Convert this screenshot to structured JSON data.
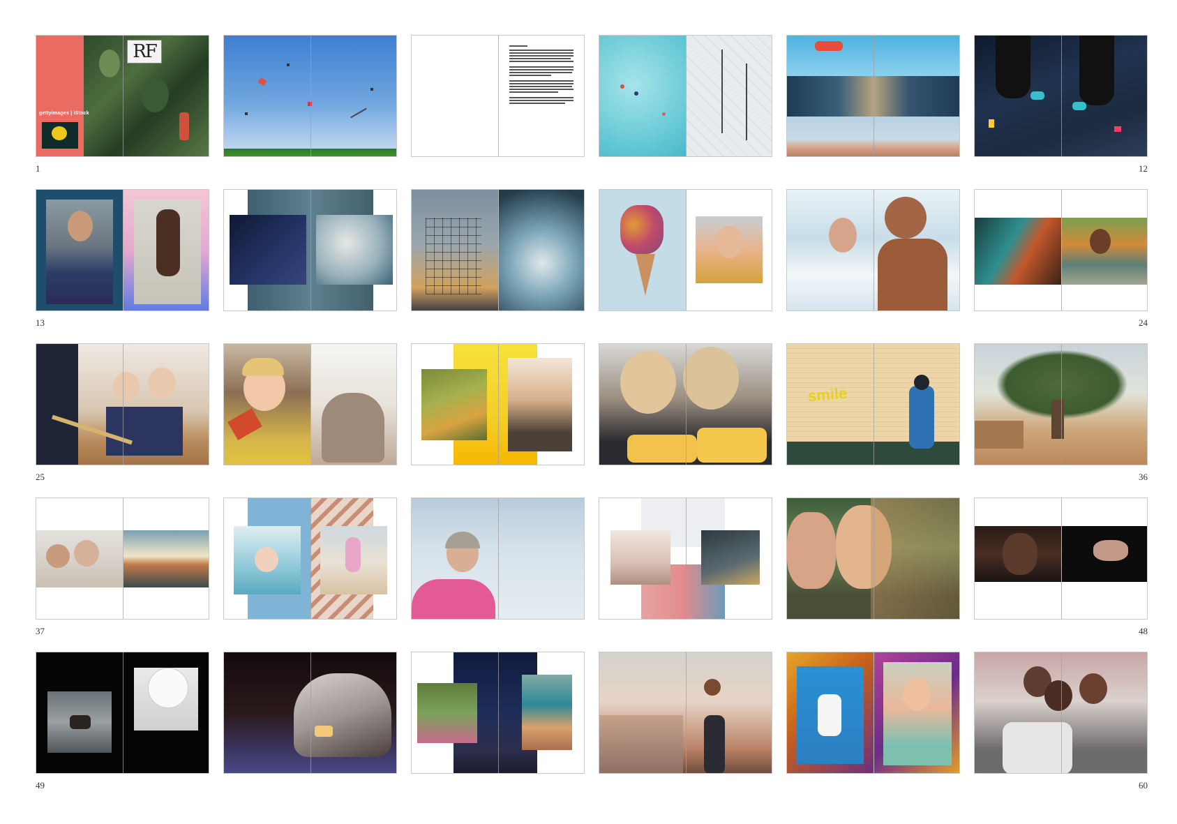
{
  "page_labels": {
    "r1_left": "1",
    "r1_right": "12",
    "r2_left": "13",
    "r2_right": "24",
    "r3_left": "25",
    "r3_right": "36",
    "r4_left": "37",
    "r4_right": "48",
    "r5_left": "49",
    "r5_right": "60"
  },
  "cover": {
    "logo_text": "RF",
    "brand_text": "gettyimages | iStock"
  },
  "wall_graffiti": "smile",
  "colors": {
    "cover_accent": "#ea6b62",
    "border": "#c9c9c9"
  }
}
